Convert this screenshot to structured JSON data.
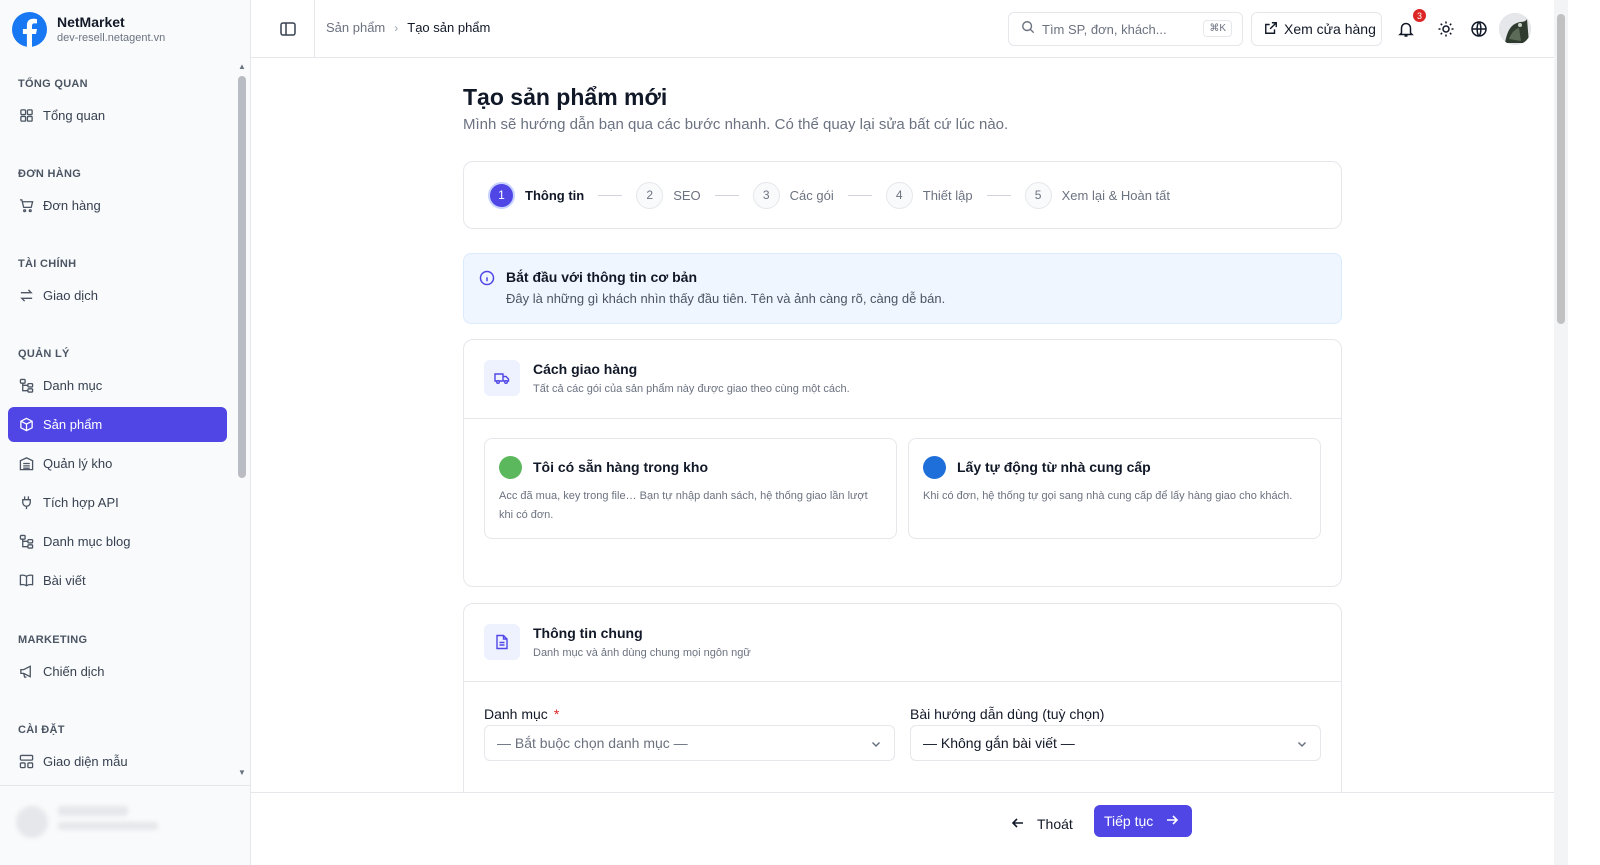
{
  "brand": {
    "name": "NetMarket",
    "domain": "dev-resell.netagent.vn",
    "logo_icon": "facebook-logo"
  },
  "sidebar": {
    "groups": [
      {
        "title": "TỔNG QUAN",
        "items": [
          {
            "label": "Tổng quan",
            "icon": "dashboard-icon"
          }
        ]
      },
      {
        "title": "ĐƠN HÀNG",
        "items": [
          {
            "label": "Đơn hàng",
            "icon": "cart-icon"
          }
        ]
      },
      {
        "title": "TÀI CHÍNH",
        "items": [
          {
            "label": "Giao dịch",
            "icon": "transfer-icon"
          }
        ]
      },
      {
        "title": "QUẢN LÝ",
        "items": [
          {
            "label": "Danh mục",
            "icon": "tree-icon"
          },
          {
            "label": "Sản phẩm",
            "icon": "box-icon",
            "active": true
          },
          {
            "label": "Quản lý kho",
            "icon": "warehouse-icon"
          },
          {
            "label": "Tích hợp API",
            "icon": "plug-icon"
          },
          {
            "label": "Danh mục blog",
            "icon": "tree-icon"
          },
          {
            "label": "Bài viết",
            "icon": "book-icon"
          }
        ]
      },
      {
        "title": "MARKETING",
        "items": [
          {
            "label": "Chiến dịch",
            "icon": "megaphone-icon"
          }
        ]
      },
      {
        "title": "CÀI ĐẶT",
        "items": [
          {
            "label": "Giao diện mẫu",
            "icon": "layout-icon"
          }
        ]
      }
    ]
  },
  "header": {
    "breadcrumb": {
      "parent": "Sản phẩm",
      "separator": "›",
      "current": "Tạo sản phẩm"
    },
    "search": {
      "placeholder": "Tìm SP, đơn, khách...",
      "shortcut": "⌘K"
    },
    "view_store_label": "Xem cửa hàng",
    "notification_count": "3"
  },
  "page": {
    "title": "Tạo sản phẩm mới",
    "subtitle": "Mình sẽ hướng dẫn bạn qua các bước nhanh. Có thể quay lại sửa bất cứ lúc nào."
  },
  "steps": [
    {
      "num": "1",
      "label": "Thông tin",
      "active": true
    },
    {
      "num": "2",
      "label": "SEO"
    },
    {
      "num": "3",
      "label": "Các gói"
    },
    {
      "num": "4",
      "label": "Thiết lập"
    },
    {
      "num": "5",
      "label": "Xem lại & Hoàn tất"
    }
  ],
  "info": {
    "title": "Bắt đầu với thông tin cơ bản",
    "text": "Đây là những gì khách nhìn thấy đầu tiên. Tên và ảnh càng rõ, càng dễ bán."
  },
  "delivery": {
    "title": "Cách giao hàng",
    "subtitle": "Tất cả các gói của sản phẩm này được giao theo cùng một cách.",
    "options": [
      {
        "title": "Tôi có sẵn hàng trong kho",
        "desc": "Acc đã mua, key trong file… Bạn tự nhập danh sách, hệ thống giao lần lượt khi có đơn.",
        "dot_color": "#5cb85c"
      },
      {
        "title": "Lấy tự động từ nhà cung cấp",
        "desc": "Khi có đơn, hệ thống tự gọi sang nhà cung cấp để lấy hàng giao cho khách.",
        "dot_color": "#1e6fd9"
      }
    ]
  },
  "general": {
    "title": "Thông tin chung",
    "subtitle": "Danh mục và ảnh dùng chung mọi ngôn ngữ",
    "category": {
      "label": "Danh mục",
      "required_mark": "*",
      "value": "— Bắt buộc chọn danh mục —"
    },
    "guide": {
      "label": "Bài hướng dẫn dùng (tuỳ chọn)",
      "value": "— Không gắn bài viết —"
    }
  },
  "footer": {
    "exit_label": "Thoát",
    "next_label": "Tiếp tục"
  },
  "colors": {
    "accent": "#4f46e5",
    "badge": "#dc2626",
    "info_bg": "#eff6ff"
  }
}
